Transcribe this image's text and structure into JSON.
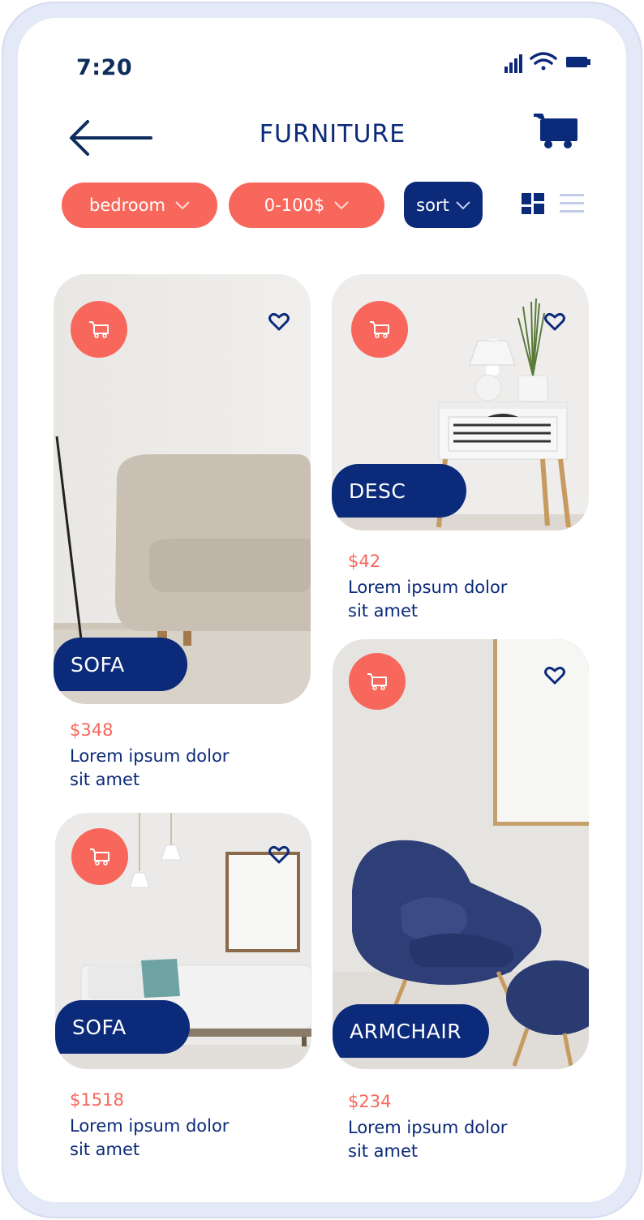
{
  "status": {
    "time": "7:20"
  },
  "header": {
    "title": "FURNITURE"
  },
  "filters": {
    "category": "bedroom",
    "price_range": "0-100$",
    "sort_label": "sort"
  },
  "products": [
    {
      "label": "SOFA",
      "price": "$348",
      "desc_line1": "Lorem ipsum dolor",
      "desc_line2": "sit amet"
    },
    {
      "label": "DESC",
      "price": "$42",
      "desc_line1": "Lorem ipsum dolor",
      "desc_line2": "sit amet"
    },
    {
      "label": "SOFA",
      "price": "$1518",
      "desc_line1": "Lorem ipsum dolor",
      "desc_line2": "sit amet"
    },
    {
      "label": "ARMCHAIR",
      "price": "$234",
      "desc_line1": "Lorem ipsum dolor",
      "desc_line2": "sit amet"
    }
  ],
  "icons": [
    "signal-icon",
    "wifi-icon",
    "battery-icon",
    "back-arrow-icon",
    "cart-icon",
    "chevron-down-icon",
    "grid-view-icon",
    "list-view-icon",
    "heart-icon"
  ],
  "colors": {
    "accent": "#f8675b",
    "primary": "#0b2a7a",
    "frame": "#e4e9f7"
  }
}
